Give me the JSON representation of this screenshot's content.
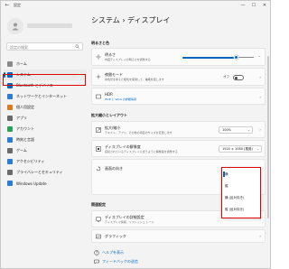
{
  "window": {
    "app_title": "設定",
    "controls": {
      "minimize": "—",
      "maximize": "☐",
      "close": "✕"
    }
  },
  "sidebar": {
    "search_placeholder": "設定の検索",
    "items": [
      {
        "label": "ホーム",
        "icon": "home-icon",
        "color": "#8a8a8a"
      },
      {
        "label": "システム",
        "icon": "system-icon",
        "color": "#0067c0",
        "selected": true
      },
      {
        "label": "Bluetooth とデバイス",
        "icon": "bluetooth-icon",
        "color": "#0067c0"
      },
      {
        "label": "ネットワークとインターネット",
        "icon": "network-icon",
        "color": "#2b7cd3"
      },
      {
        "label": "個人用設定",
        "icon": "brush-icon",
        "color": "#d97b22"
      },
      {
        "label": "アプリ",
        "icon": "apps-icon",
        "color": "#6b6b6b"
      },
      {
        "label": "アカウント",
        "icon": "account-icon",
        "color": "#2aa05a"
      },
      {
        "label": "時刻と言語",
        "icon": "clock-icon",
        "color": "#2b7cd3"
      },
      {
        "label": "ゲーム",
        "icon": "game-icon",
        "color": "#6b6b6b"
      },
      {
        "label": "アクセシビリティ",
        "icon": "accessibility-icon",
        "color": "#2b7cd3"
      },
      {
        "label": "プライバシーとセキュリティ",
        "icon": "shield-icon",
        "color": "#6b6b6b"
      },
      {
        "label": "Windows Update",
        "icon": "update-icon",
        "color": "#2b7cd3"
      }
    ]
  },
  "main": {
    "breadcrumb_parent": "システム",
    "breadcrumb_sep": "›",
    "breadcrumb_current": "ディスプレイ",
    "section_brightness": "明るさと色",
    "brightness_label": "明るさ",
    "brightness_sub": "内蔵ディスプレイの明るさを調整する",
    "brightness_level_pct": 74,
    "nightlight_label": "夜間モード",
    "nightlight_sub": "青色光を抑えた暖色を使用して、睡眠を促します",
    "nightlight_state": "オフ",
    "hdr_label": "HDR",
    "hdr_sub": "HDR と WCG の詳細情報",
    "section_scale": "拡大縮小とレイアウト",
    "scale_label": "拡大/縮小",
    "scale_sub": "テキスト、アプリ、その他の項目のサイズを変更します",
    "scale_value": "100%",
    "resolution_label": "ディスプレイの解像度",
    "resolution_sub": "接続されているディスプレイに合うように解像度を調整する",
    "resolution_value": "1920 × 1080 (推奨)",
    "orientation_label": "画面の向き",
    "section_related": "関連設定",
    "advanced_label": "ディスプレイの詳細設定",
    "advanced_sub": "ディスプレイ情報、リフレッシュ レート",
    "graphics_label": "グラフィック",
    "help_link": "ヘルプを表示",
    "feedback_link": "フィードバックの送信"
  },
  "orientation_menu": {
    "options": [
      "横",
      "縦",
      "横 (反対向き)",
      "縦 (反対向き)"
    ],
    "selected_index": 0
  },
  "colors": {
    "accent": "#0067c0",
    "highlight": "#e00000"
  }
}
